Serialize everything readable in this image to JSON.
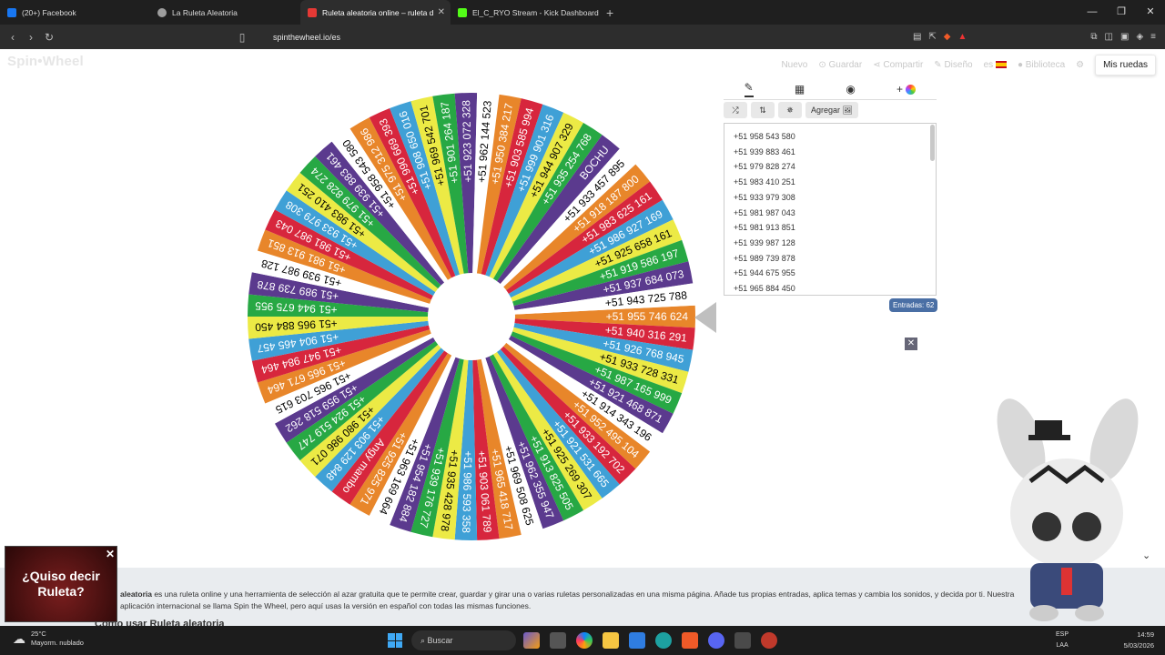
{
  "browser": {
    "tabs": [
      {
        "label": "(20+) Facebook",
        "color": "#1877f2"
      },
      {
        "label": "La Ruleta Aleatoria",
        "color": "#9e9e9e"
      },
      {
        "label": "Ruleta aleatoria online – ruleta d",
        "color": "#e53935"
      },
      {
        "label": "El_C_RYO Stream - Kick Dashboard",
        "color": "#53fc18"
      }
    ],
    "url": "spinthewheel.io/es"
  },
  "site": {
    "logo": "Spin•Wheel",
    "nav": {
      "nuevo": "Nuevo",
      "guardar": "Guardar",
      "compartir": "Compartir",
      "diseno": "Diseño",
      "lang": "es",
      "biblioteca": "Biblioteca",
      "mis_ruedas": "Mis ruedas"
    }
  },
  "wheel": {
    "segments": [
      "+51 955 746 624",
      "+51 940 316 291",
      "+51 926 768 945",
      "+51 933 728 331",
      "+51 987 165 999",
      "+51 921 468 871",
      "+51 914 343 196",
      "+51 952 495 104",
      "+51 933 192 702",
      "+51 921 531 665",
      "+51 925 269 307",
      "+51 913 825 505",
      "+51 962 355 947",
      "+51 969 508 625",
      "+51 965 418 717",
      "+51 903 061 789",
      "+51 986 593 358",
      "+51 935 428 978",
      "+51 939 176 727",
      "+51 954 182 884",
      "+51 963 169 664",
      "+51 925 825 971",
      "Angy mambo",
      "+51 903 129 848",
      "+51 980 986 071",
      "+51 924 519 747",
      "+51 959 518 262",
      "+51 965 703 615",
      "+51 965 671 464",
      "+51 947 984 464",
      "+51 904 465 457",
      "+51 965 884 450",
      "+51 944 675 955",
      "+51 989 739 878",
      "+51 939 987 128",
      "+51 981 913 851",
      "+51 981 987 043",
      "+51 933 979 308",
      "+51 983 410 251",
      "+51 979 828 274",
      "+51 939 883 461",
      "+51 958 543 580",
      "+51 975 312 986",
      "+51 990 669 393",
      "+51 908 650 016",
      "+51 969 542 701",
      "+51 901 264 187",
      "+51 923 072 328",
      "+51 962 144 523",
      "+51 950 384 217",
      "+51 903 585 994",
      "+51 999 901 316",
      "+51 944 907 329",
      "+51 935 254 768",
      "BOCHU",
      "+51 933 457 895",
      "+51 918 187 800",
      "+51 983 625 161",
      "+51 986 927 169",
      "+51 925 658 161",
      "+51 919 586 197",
      "+51 937 684 073",
      "+51 943 725 788"
    ],
    "colors": [
      "#e8862a",
      "#d7263d",
      "#3fa0d6",
      "#ecea45",
      "#27a844",
      "#5b3a8e",
      "#ffffff"
    ]
  },
  "panel": {
    "tab_icons": [
      "pencil-icon",
      "clipboard-icon",
      "hide-icon",
      "palette-icon"
    ],
    "buttons": {
      "shuffle": "⤮",
      "sort": "⇅",
      "image": "✵",
      "add_image": "Agregar 🖼"
    },
    "entries": [
      "+51 958 543 580",
      "+51 939 883 461",
      "+51 979 828 274",
      "+51 983 410 251",
      "+51 933 979 308",
      "+51 981 987 043",
      "+51 981 913 851",
      "+51 939 987 128",
      "+51 989 739 878",
      "+51 944 675 955",
      "+51 965 884 450"
    ],
    "count": "Entradas: 62"
  },
  "footer": {
    "desc_bold": "aleatoria",
    "desc": " es una ruleta online y una herramienta de selección al azar gratuita que te permite crear, guardar y girar una o varias ruletas personalizadas en una misma página. Añade tus propias entradas, aplica temas y cambia los sonidos, y decida por ti. Nuestra aplicación internacional se llama Spin the Wheel, pero aquí usas la versión en español con todas las mismas funciones.",
    "howto": "Cómo usar Ruleta aleatoria",
    "ad": "¿Quiso decir Ruleta?"
  },
  "taskbar": {
    "temp": "25°C",
    "weather": "Mayorm. nublado",
    "search": "Buscar",
    "lang1": "ESP",
    "lang2": "LAA",
    "time": "14:59",
    "date": "5/03/2026"
  }
}
